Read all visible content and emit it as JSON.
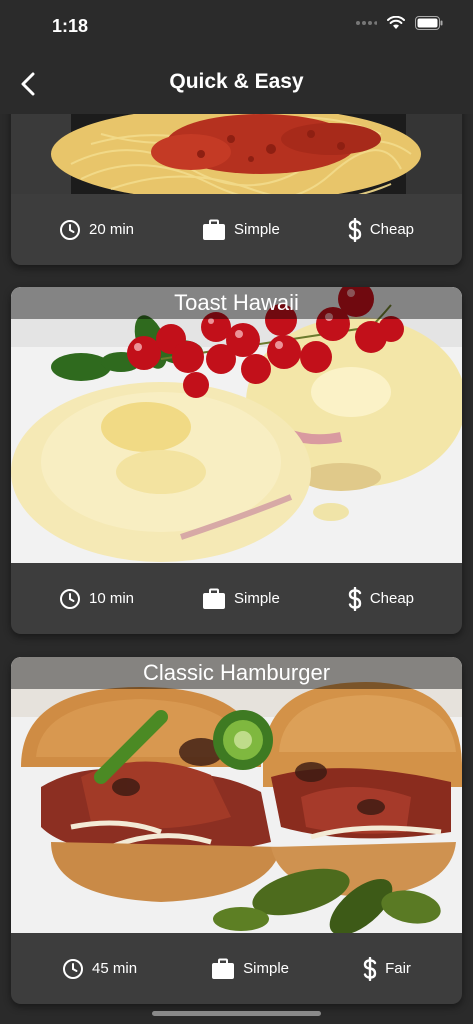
{
  "status": {
    "time": "1:18"
  },
  "header": {
    "title": "Quick & Easy"
  },
  "meals": [
    {
      "title": "",
      "duration": "20 min",
      "complexity": "Simple",
      "affordability": "Cheap"
    },
    {
      "title": "Toast Hawaii",
      "duration": "10 min",
      "complexity": "Simple",
      "affordability": "Cheap"
    },
    {
      "title": "Classic Hamburger",
      "duration": "45 min",
      "complexity": "Simple",
      "affordability": "Fair"
    }
  ],
  "icons": {
    "duration": "clock-icon",
    "complexity": "briefcase-icon",
    "affordability": "dollar-icon"
  }
}
